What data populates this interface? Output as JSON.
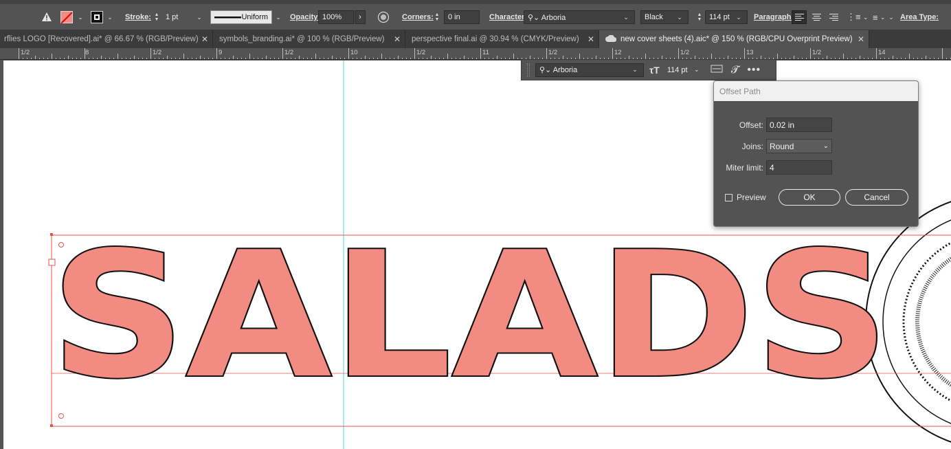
{
  "control_bar": {
    "stroke_label": "Stroke:",
    "stroke_weight": "1 pt",
    "profile": "Uniform",
    "opacity_label": "Opacity:",
    "opacity": "100%",
    "corners_label": "Corners:",
    "corners_value": "0 in",
    "character_label": "Character:",
    "font_family": "Arboria",
    "font_style": "Black",
    "font_size": "114 pt",
    "paragraph_label": "Paragraph:",
    "area_type_label": "Area Type:"
  },
  "tabs": [
    {
      "label": "rflies LOGO [Recovered].ai* @ 66.67 % (RGB/Preview)"
    },
    {
      "label": "symbols_branding.ai* @ 100 % (RGB/Preview)"
    },
    {
      "label": "perspective final.ai @ 30.94 % (CMYK/Preview)"
    },
    {
      "label": "new cover sheets (4).aic* @ 150 % (RGB/CPU Overprint Preview)"
    }
  ],
  "ruler_labels": [
    "1/2",
    "8",
    "1/2",
    "9",
    "1/2",
    "10",
    "1/2",
    "11",
    "1/2",
    "12",
    "1/2",
    "13",
    "1/2",
    "14"
  ],
  "float_panel": {
    "font_family": "Arboria",
    "font_size": "114 pt"
  },
  "dialog": {
    "title": "Offset Path",
    "offset_label": "Offset:",
    "offset_value": "0.02 in",
    "joins_label": "Joins:",
    "joins_value": "Round",
    "miter_label": "Miter limit:",
    "miter_value": "4",
    "preview_label": "Preview",
    "preview_checked": false,
    "ok_label": "OK",
    "cancel_label": "Cancel"
  },
  "artwork": {
    "text": "SALADS",
    "fill_color": "#f28b82",
    "stroke_color": "#111111",
    "guide_color": "#4fd6e0",
    "selection_color": "#e8554a"
  }
}
